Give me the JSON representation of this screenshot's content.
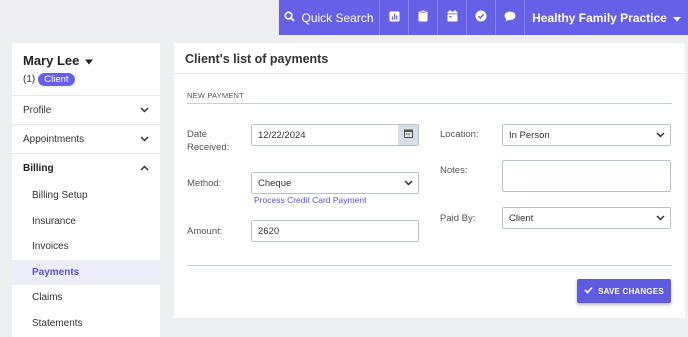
{
  "topbar": {
    "search_label": "Quick Search",
    "practice_name": "Healthy Family Practice",
    "icons": [
      "search-icon",
      "chart-icon",
      "clipboard-icon",
      "calendar-icon",
      "check-circle-icon",
      "chat-icon",
      "chevron-down-icon"
    ],
    "accent_color": "#6560e6"
  },
  "client": {
    "name": "Mary Lee",
    "count": "(1)",
    "badge": "Client"
  },
  "sidebar": {
    "items": [
      {
        "label": "Profile"
      },
      {
        "label": "Appointments"
      },
      {
        "label": "Billing"
      }
    ],
    "billing_subitems": [
      {
        "label": "Billing Setup"
      },
      {
        "label": "Insurance"
      },
      {
        "label": "Invoices"
      },
      {
        "label": "Payments"
      },
      {
        "label": "Claims"
      },
      {
        "label": "Statements"
      }
    ],
    "active_subitem": "Payments"
  },
  "main": {
    "title": "Client's list of payments",
    "section_label": "NEW PAYMENT",
    "date_label": "Date Received:",
    "date_value": "12/22/2024",
    "method_label": "Method:",
    "method_value": "Cheque",
    "process_link": "Process Credit Card Payment",
    "amount_label": "Amount:",
    "amount_value": "2620",
    "location_label": "Location:",
    "location_value": "In Person",
    "notes_label": "Notes:",
    "notes_value": "",
    "paid_by_label": "Paid By:",
    "paid_by_value": "Client",
    "save_label": "SAVE CHANGES"
  }
}
